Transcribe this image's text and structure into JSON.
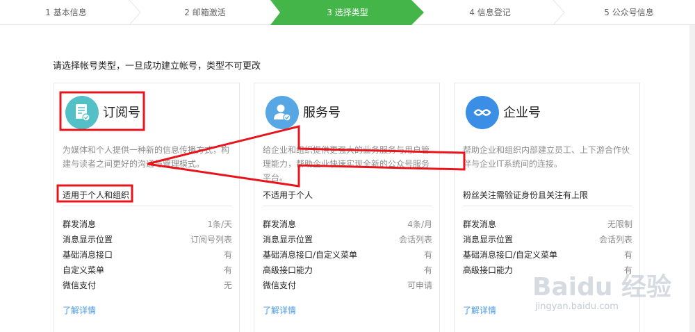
{
  "steps": [
    {
      "label": "1 基本信息",
      "state": "done"
    },
    {
      "label": "2 邮箱激活",
      "state": "done"
    },
    {
      "label": "3 选择类型",
      "state": "active"
    },
    {
      "label": "4 信息登记",
      "state": "todo"
    },
    {
      "label": "5 公众号信息",
      "state": "todo"
    }
  ],
  "colors": {
    "step_active": "#44b549",
    "link": "#459ae9",
    "annotation": "#e8141c"
  },
  "page_title": "请选择帐号类型，一旦成功建立帐号，类型不可更改",
  "cards": [
    {
      "title": "订阅号",
      "icon": "subscription-doc-icon",
      "icon_color": "#53c0c8",
      "desc": "为媒体和个人提供一种新的信息传播方式，构建与读者之间更好的沟通与管理模式。",
      "fit": "适用于个人和组织",
      "features": [
        {
          "key": "群发消息",
          "value": "1条/天"
        },
        {
          "key": "消息显示位置",
          "value": "订阅号列表"
        },
        {
          "key": "基础消息接口",
          "value": "有"
        },
        {
          "key": "自定义菜单",
          "value": "有"
        },
        {
          "key": "微信支付",
          "value": "无"
        }
      ],
      "link": "了解详情"
    },
    {
      "title": "服务号",
      "icon": "service-person-icon",
      "icon_color": "#56a7e3",
      "desc": "给企业和组织提供更强大的业务服务与用户管理能力，帮助企业快速实现全新的公众号服务平台。",
      "fit": "不适用于个人",
      "features": [
        {
          "key": "群发消息",
          "value": "4条/月"
        },
        {
          "key": "消息显示位置",
          "value": "会话列表"
        },
        {
          "key": "基础消息接口/自定义菜单",
          "value": "有"
        },
        {
          "key": "高级接口能力",
          "value": "有"
        },
        {
          "key": "微信支付",
          "value": "可申请"
        }
      ],
      "link": "了解详情"
    },
    {
      "title": "企业号",
      "icon": "enterprise-link-icon",
      "icon_color": "#3a8ee6",
      "desc": "帮助企业和组织内部建立员工、上下游合作伙伴与企业IT系统间的连接。",
      "fit": "粉丝关注需验证身份且关注有上限",
      "features": [
        {
          "key": "群发消息",
          "value": "无限制"
        },
        {
          "key": "消息显示位置",
          "value": "会话列表"
        },
        {
          "key": "基础消息接口/自定义菜单",
          "value": "有"
        },
        {
          "key": "高级接口能力",
          "value": "有"
        }
      ],
      "link": "了解详情"
    }
  ],
  "watermark": {
    "logo": "Baidu 经验",
    "url": "jingyan.baidu.com"
  }
}
